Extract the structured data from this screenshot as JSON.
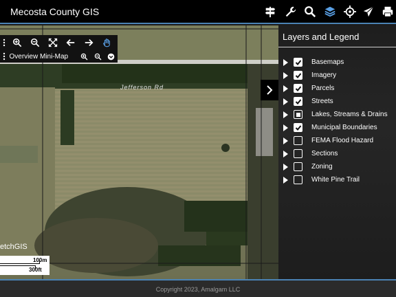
{
  "header": {
    "title": "Mecosta County GIS",
    "icons": [
      "signpost-icon",
      "wrench-icon",
      "search-icon",
      "layers-icon",
      "location-icon",
      "send-icon",
      "print-icon"
    ]
  },
  "toolbar": {
    "tools": [
      "zoom-in",
      "zoom-out",
      "full-extent",
      "back",
      "forward",
      "pan"
    ]
  },
  "minimap": {
    "label": "Overview Mini-Map"
  },
  "map": {
    "road_label": "Jefferson Rd",
    "watermark": "etchGIS",
    "scale_metric": "100m",
    "scale_imperial": "300ft"
  },
  "layers_panel": {
    "title": "Layers and Legend",
    "layers": [
      {
        "name": "Basemaps",
        "state": "checked"
      },
      {
        "name": "Imagery",
        "state": "checked"
      },
      {
        "name": "Parcels",
        "state": "checked"
      },
      {
        "name": "Streets",
        "state": "checked"
      },
      {
        "name": "Lakes, Streams & Drains",
        "state": "partial"
      },
      {
        "name": "Municipal Boundaries",
        "state": "checked"
      },
      {
        "name": "FEMA Flood Hazard",
        "state": "unchecked"
      },
      {
        "name": "Sections",
        "state": "unchecked"
      },
      {
        "name": "Zoning",
        "state": "unchecked"
      },
      {
        "name": "White Pine Trail",
        "state": "unchecked"
      }
    ]
  },
  "footer": {
    "copyright": "Copyright 2023, Amalgam LLC"
  },
  "colors": {
    "accent": "#4b83b5",
    "header_bg": "#000000",
    "panel_bg": "#1e1e1e"
  }
}
